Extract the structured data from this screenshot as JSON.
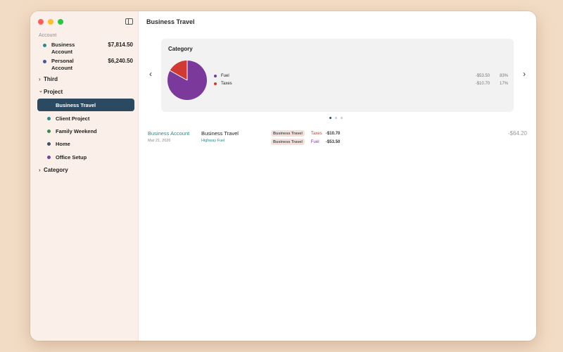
{
  "sidebar": {
    "section_label": "Account",
    "accounts": [
      {
        "name": "Business Account",
        "amount": "$7,814.50",
        "color": "#2a8a8a"
      },
      {
        "name": "Personal Account",
        "amount": "$6,240.50",
        "color": "#3a5aa8"
      }
    ],
    "third_label": "Third",
    "project_label": "Project",
    "projects": [
      {
        "name": "Business Travel",
        "color": "#2b4a62"
      },
      {
        "name": "Client Project",
        "color": "#2a8a8a"
      },
      {
        "name": "Family Weekend",
        "color": "#3a8a4a"
      },
      {
        "name": "Home",
        "color": "#3d4f63"
      },
      {
        "name": "Office Setup",
        "color": "#7a3fa0"
      }
    ],
    "category_label": "Category"
  },
  "main": {
    "title": "Business Travel",
    "card": {
      "title": "Category",
      "legend": [
        {
          "name": "Fuel",
          "value": "-$53.50",
          "pct": "83%",
          "color": "#7b3a9b"
        },
        {
          "name": "Taxes",
          "value": "-$10.70",
          "pct": "17%",
          "color": "#d13a32"
        }
      ]
    },
    "transaction": {
      "account": "Business Account",
      "date": "Mar 21, 2026",
      "title": "Business Travel",
      "subtitle": "Highway Fuel",
      "splits": [
        {
          "tag": "Business Travel",
          "category": "Taxes",
          "amount": "-$10.70",
          "color": "#d13a32"
        },
        {
          "tag": "Business Travel",
          "category": "Fuel",
          "amount": "-$53.50",
          "color": "#7b3a9b"
        }
      ],
      "total": "-$64.20"
    }
  },
  "icons": {
    "prev": "‹",
    "next": "›",
    "chevron_right": "›",
    "chevron_down": "⌄"
  }
}
